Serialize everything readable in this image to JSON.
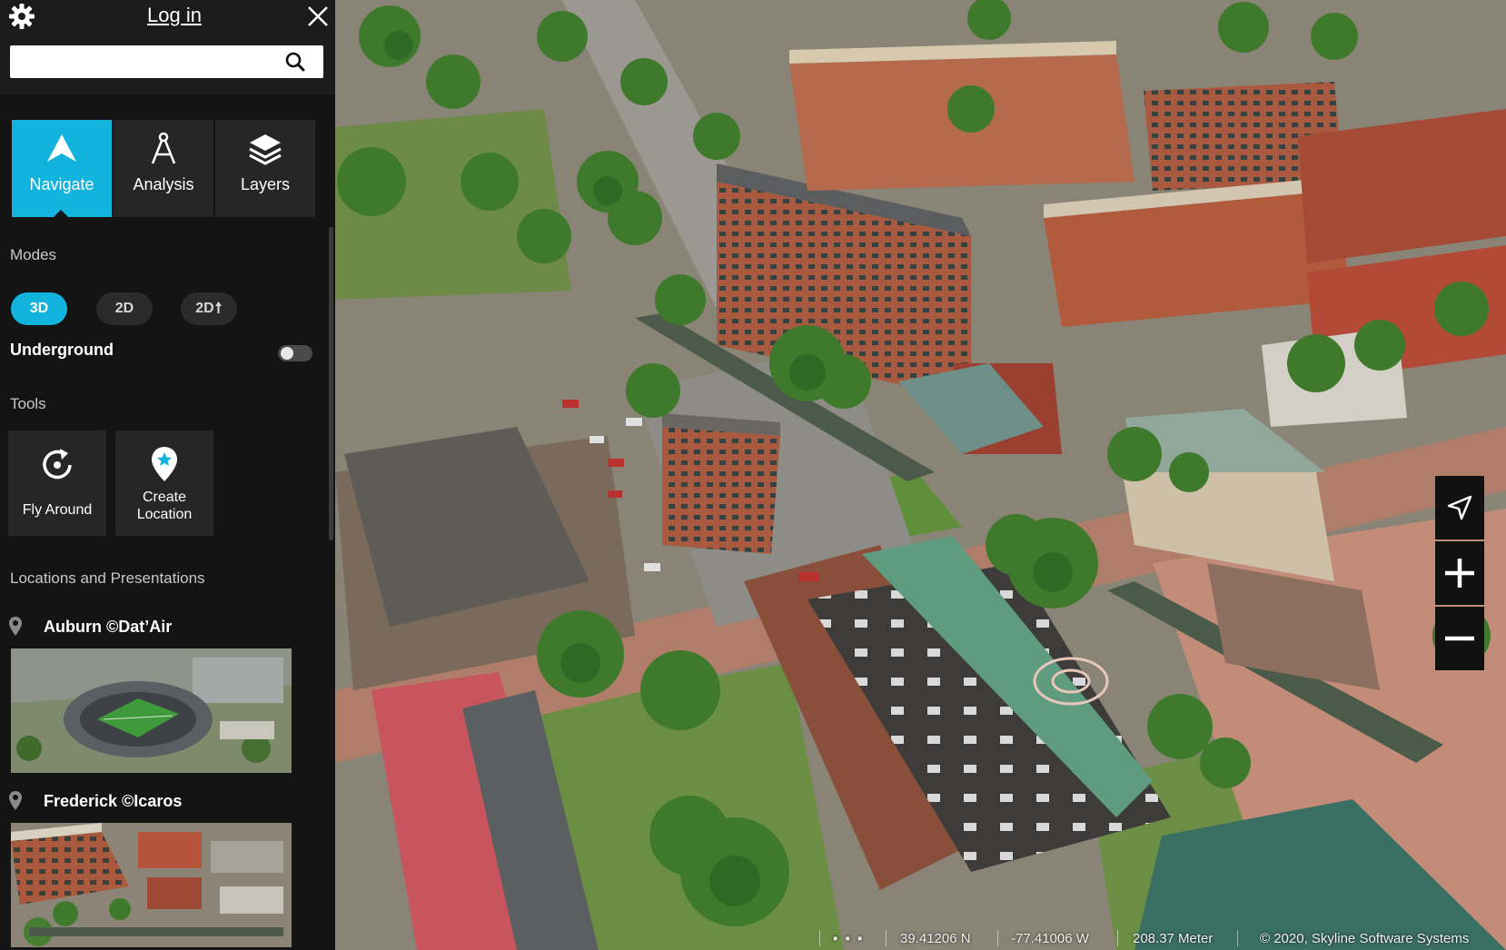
{
  "header": {
    "login_label": "Log in",
    "search_value": "",
    "search_placeholder": "",
    "settings_icon": "gear-icon",
    "close_icon": "close-icon",
    "search_icon": "search-icon"
  },
  "tabs": [
    {
      "label": "Navigate",
      "icon": "navigate-arrow-icon",
      "active": true
    },
    {
      "label": "Analysis",
      "icon": "compass-tool-icon",
      "active": false
    },
    {
      "label": "Layers",
      "icon": "layers-stack-icon",
      "active": false
    }
  ],
  "modes": {
    "title": "Modes",
    "buttons": [
      {
        "label": "3D",
        "active": true
      },
      {
        "label": "2D",
        "active": false
      },
      {
        "label": "2D",
        "suffix_icon": "north-arrow-icon",
        "active": false
      }
    ],
    "underground_label": "Underground",
    "underground_on": false
  },
  "tools": {
    "title": "Tools",
    "items": [
      {
        "label": "Fly Around",
        "icon": "fly-around-icon"
      },
      {
        "label_line1": "Create",
        "label_line2": "Location",
        "icon": "map-pin-star-icon"
      }
    ]
  },
  "locations": {
    "title": "Locations and Presentations",
    "items": [
      {
        "name": "Auburn ©Dat’Air",
        "thumbnail": "stadium-aerial-thumbnail"
      },
      {
        "name": "Frederick ©Icaros",
        "thumbnail": "town-aerial-thumbnail"
      }
    ]
  },
  "map_controls": [
    "compass-pointer-icon",
    "zoom-in-icon",
    "zoom-out-icon"
  ],
  "status_bar": {
    "dots": "▪ ▪ ▪",
    "latitude": "39.41206 N",
    "longitude": "-77.41006 W",
    "altitude": "208.37 Meter",
    "copyright": "© 2020, Skyline Software Systems"
  },
  "colors": {
    "accent": "#12b4dd",
    "panel_bg": "#141414",
    "tile_bg": "#262626"
  }
}
